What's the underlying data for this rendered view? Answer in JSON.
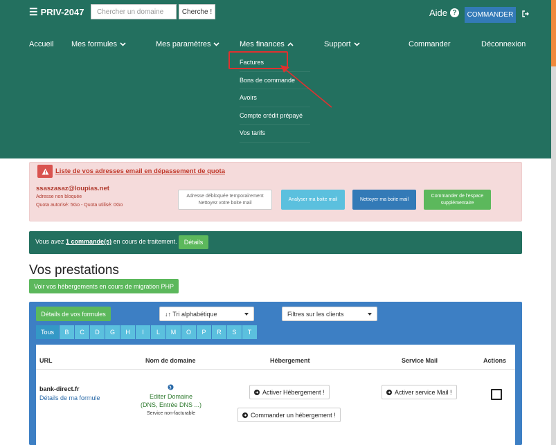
{
  "header": {
    "brand": "PRIV-2047",
    "search_placeholder": "Chercher un domaine",
    "search_button": "Cherche !",
    "help_label": "Aide",
    "commander_button": "COMMANDER"
  },
  "nav": {
    "items": [
      "Accueil",
      "Mes formules",
      "Mes paramètres",
      "Mes finances",
      "Support",
      "Commander",
      "Déconnexion"
    ]
  },
  "finances_menu": {
    "items": [
      "Factures",
      "Bons de commande",
      "Avoirs",
      "Compte crédit prépayé",
      "Vos tarifs"
    ]
  },
  "quota_alert": {
    "title": "Liste de vos adresses email en dépassement de quota",
    "email": "ssaszasaz@loupias.net",
    "status": "Adresse non bloquée",
    "usage": "Quota autorisé: 5Go - Quota utilisé: 0Go",
    "unlock_line1": "Adresse débloquée temporairement",
    "unlock_line2": "Nettoyez votre boite mail",
    "analyze": "Analyser ma boite mail",
    "clean": "Nettoyer ma boite mail",
    "order_space_line1": "Commander de l'espace",
    "order_space_line2": "supplémentaire"
  },
  "orders": {
    "prefix": "Vous avez",
    "link": "1 commande(s)",
    "suffix": "en cours de traitement.",
    "details_button": "Détails"
  },
  "services": {
    "title": "Vos prestations",
    "migration_button": "Voir vos hébergements en cours de migration PHP"
  },
  "panel": {
    "formulas_button": "Détails de vos formules",
    "sort_select": "Tri alphabétique",
    "filter_select": "Filtres sur les clients",
    "letters": [
      "Tous",
      "B",
      "C",
      "D",
      "G",
      "H",
      "I",
      "L",
      "M",
      "O",
      "P",
      "R",
      "S",
      "T"
    ]
  },
  "table": {
    "headers": {
      "url": "URL",
      "domain": "Nom de domaine",
      "hosting": "Hébergement",
      "mail": "Service Mail",
      "actions": "Actions"
    },
    "row": {
      "url": "bank-direct.fr",
      "details_link": "Détails de ma formule",
      "domain_edit": "Editer Domaine",
      "domain_dns": "(DNS, Entrée DNS ...)",
      "domain_billing": "Service non-facturable",
      "activate_hosting": "Activer Hébergement !",
      "order_hosting": "Commander un hébergement !",
      "activate_mail": "Activer service Mail !"
    }
  },
  "colors": {
    "header_bg": "#23705f",
    "primary": "#337ab7",
    "success": "#5cb85c",
    "info": "#5bc0de",
    "danger": "#d9534f",
    "annotation": "#e0312f"
  }
}
